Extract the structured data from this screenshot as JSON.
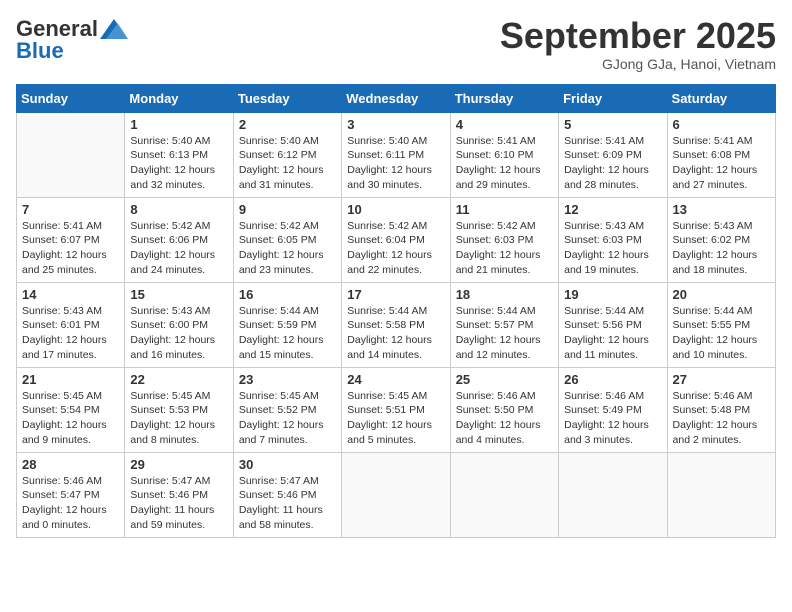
{
  "header": {
    "logo_general": "General",
    "logo_blue": "Blue",
    "month_title": "September 2025",
    "location": "GJong GJa, Hanoi, Vietnam"
  },
  "days_of_week": [
    "Sunday",
    "Monday",
    "Tuesday",
    "Wednesday",
    "Thursday",
    "Friday",
    "Saturday"
  ],
  "weeks": [
    [
      {
        "day": "",
        "info": ""
      },
      {
        "day": "1",
        "info": "Sunrise: 5:40 AM\nSunset: 6:13 PM\nDaylight: 12 hours\nand 32 minutes."
      },
      {
        "day": "2",
        "info": "Sunrise: 5:40 AM\nSunset: 6:12 PM\nDaylight: 12 hours\nand 31 minutes."
      },
      {
        "day": "3",
        "info": "Sunrise: 5:40 AM\nSunset: 6:11 PM\nDaylight: 12 hours\nand 30 minutes."
      },
      {
        "day": "4",
        "info": "Sunrise: 5:41 AM\nSunset: 6:10 PM\nDaylight: 12 hours\nand 29 minutes."
      },
      {
        "day": "5",
        "info": "Sunrise: 5:41 AM\nSunset: 6:09 PM\nDaylight: 12 hours\nand 28 minutes."
      },
      {
        "day": "6",
        "info": "Sunrise: 5:41 AM\nSunset: 6:08 PM\nDaylight: 12 hours\nand 27 minutes."
      }
    ],
    [
      {
        "day": "7",
        "info": "Sunrise: 5:41 AM\nSunset: 6:07 PM\nDaylight: 12 hours\nand 25 minutes."
      },
      {
        "day": "8",
        "info": "Sunrise: 5:42 AM\nSunset: 6:06 PM\nDaylight: 12 hours\nand 24 minutes."
      },
      {
        "day": "9",
        "info": "Sunrise: 5:42 AM\nSunset: 6:05 PM\nDaylight: 12 hours\nand 23 minutes."
      },
      {
        "day": "10",
        "info": "Sunrise: 5:42 AM\nSunset: 6:04 PM\nDaylight: 12 hours\nand 22 minutes."
      },
      {
        "day": "11",
        "info": "Sunrise: 5:42 AM\nSunset: 6:03 PM\nDaylight: 12 hours\nand 21 minutes."
      },
      {
        "day": "12",
        "info": "Sunrise: 5:43 AM\nSunset: 6:03 PM\nDaylight: 12 hours\nand 19 minutes."
      },
      {
        "day": "13",
        "info": "Sunrise: 5:43 AM\nSunset: 6:02 PM\nDaylight: 12 hours\nand 18 minutes."
      }
    ],
    [
      {
        "day": "14",
        "info": "Sunrise: 5:43 AM\nSunset: 6:01 PM\nDaylight: 12 hours\nand 17 minutes."
      },
      {
        "day": "15",
        "info": "Sunrise: 5:43 AM\nSunset: 6:00 PM\nDaylight: 12 hours\nand 16 minutes."
      },
      {
        "day": "16",
        "info": "Sunrise: 5:44 AM\nSunset: 5:59 PM\nDaylight: 12 hours\nand 15 minutes."
      },
      {
        "day": "17",
        "info": "Sunrise: 5:44 AM\nSunset: 5:58 PM\nDaylight: 12 hours\nand 14 minutes."
      },
      {
        "day": "18",
        "info": "Sunrise: 5:44 AM\nSunset: 5:57 PM\nDaylight: 12 hours\nand 12 minutes."
      },
      {
        "day": "19",
        "info": "Sunrise: 5:44 AM\nSunset: 5:56 PM\nDaylight: 12 hours\nand 11 minutes."
      },
      {
        "day": "20",
        "info": "Sunrise: 5:44 AM\nSunset: 5:55 PM\nDaylight: 12 hours\nand 10 minutes."
      }
    ],
    [
      {
        "day": "21",
        "info": "Sunrise: 5:45 AM\nSunset: 5:54 PM\nDaylight: 12 hours\nand 9 minutes."
      },
      {
        "day": "22",
        "info": "Sunrise: 5:45 AM\nSunset: 5:53 PM\nDaylight: 12 hours\nand 8 minutes."
      },
      {
        "day": "23",
        "info": "Sunrise: 5:45 AM\nSunset: 5:52 PM\nDaylight: 12 hours\nand 7 minutes."
      },
      {
        "day": "24",
        "info": "Sunrise: 5:45 AM\nSunset: 5:51 PM\nDaylight: 12 hours\nand 5 minutes."
      },
      {
        "day": "25",
        "info": "Sunrise: 5:46 AM\nSunset: 5:50 PM\nDaylight: 12 hours\nand 4 minutes."
      },
      {
        "day": "26",
        "info": "Sunrise: 5:46 AM\nSunset: 5:49 PM\nDaylight: 12 hours\nand 3 minutes."
      },
      {
        "day": "27",
        "info": "Sunrise: 5:46 AM\nSunset: 5:48 PM\nDaylight: 12 hours\nand 2 minutes."
      }
    ],
    [
      {
        "day": "28",
        "info": "Sunrise: 5:46 AM\nSunset: 5:47 PM\nDaylight: 12 hours\nand 0 minutes."
      },
      {
        "day": "29",
        "info": "Sunrise: 5:47 AM\nSunset: 5:46 PM\nDaylight: 11 hours\nand 59 minutes."
      },
      {
        "day": "30",
        "info": "Sunrise: 5:47 AM\nSunset: 5:46 PM\nDaylight: 11 hours\nand 58 minutes."
      },
      {
        "day": "",
        "info": ""
      },
      {
        "day": "",
        "info": ""
      },
      {
        "day": "",
        "info": ""
      },
      {
        "day": "",
        "info": ""
      }
    ]
  ]
}
